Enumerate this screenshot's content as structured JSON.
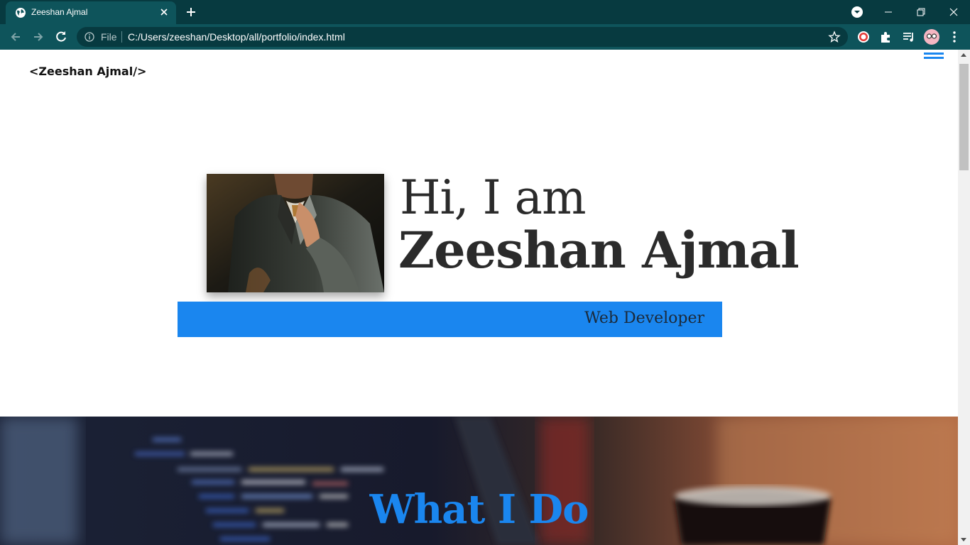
{
  "browser": {
    "tab_title": "Zeeshan Ajmal",
    "omnibox_scheme_label": "File",
    "url": "C:/Users/zeeshan/Desktop/all/portfolio/index.html"
  },
  "page": {
    "logo": "<Zeeshan Ajmal/>",
    "hero": {
      "greeting": "Hi, I am",
      "name": "Zeeshan Ajmal",
      "role": "Web Developer"
    },
    "section_title": "What I Do"
  },
  "colors": {
    "accent": "#1a86ef",
    "chrome_dark": "#073a40",
    "chrome_light": "#0e545b",
    "text_dark": "#2b2b2b"
  }
}
